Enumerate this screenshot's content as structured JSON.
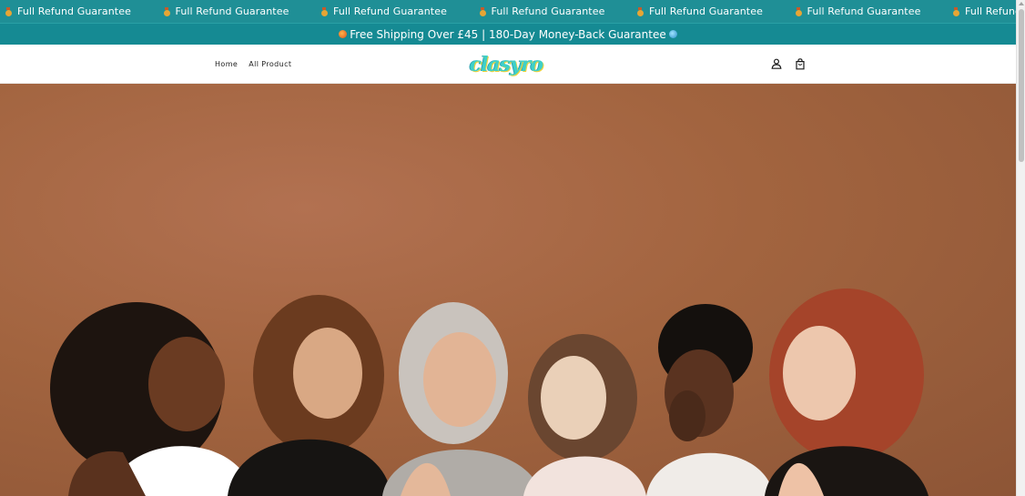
{
  "marquee": {
    "items": [
      {
        "icon": "medal-icon",
        "text": "Full Refund Guarantee"
      },
      {
        "icon": "medal-icon",
        "text": "Full Refund Guarantee"
      },
      {
        "icon": "medal-icon",
        "text": "Full Refund Guarantee"
      },
      {
        "icon": "medal-icon",
        "text": "Full Refund Guarantee"
      },
      {
        "icon": "medal-icon",
        "text": "Full Refund Guarantee"
      },
      {
        "icon": "medal-icon",
        "text": "Full Refund Guarantee"
      },
      {
        "icon": "medal-icon",
        "text": "Full Refund"
      }
    ],
    "background": "#1f8f96"
  },
  "announcement": {
    "text": "Free Shipping Over £45 | 180-Day Money-Back Guarantee",
    "background": "#158a93"
  },
  "header": {
    "nav": [
      {
        "label": "Home"
      },
      {
        "label": "All Product"
      }
    ],
    "logo_text": "clasyro",
    "icons": [
      "account-icon",
      "cart-icon"
    ]
  },
  "hero": {
    "image": "group-of-smiling-women-photo",
    "background": "#a2643f"
  }
}
